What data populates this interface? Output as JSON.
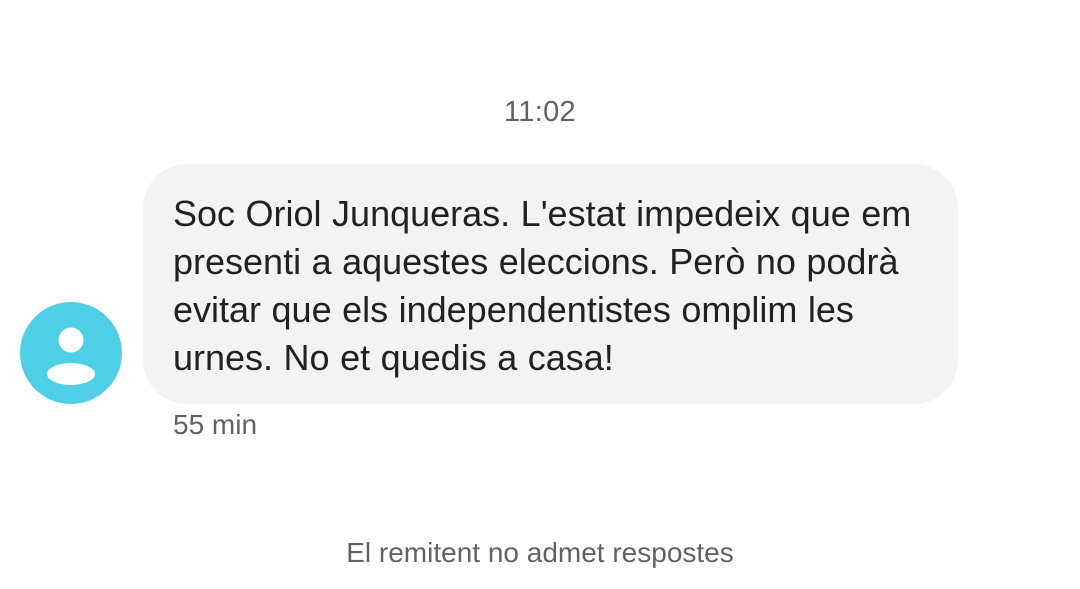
{
  "conversation": {
    "timestamp": "11:02"
  },
  "message": {
    "sender_avatar_icon": "person-icon",
    "avatar_color": "#4fcfe6",
    "bubble_color": "#f1f3f4",
    "text": "Soc Oriol Junqueras. L'estat impedeix que em presenti a aquestes eleccions. Però no podrà evitar que els independentistes omplim les urnes. No et quedis a casa!",
    "relative_time": "55 min"
  },
  "footer": {
    "notice": "El remitent no admet respostes"
  }
}
